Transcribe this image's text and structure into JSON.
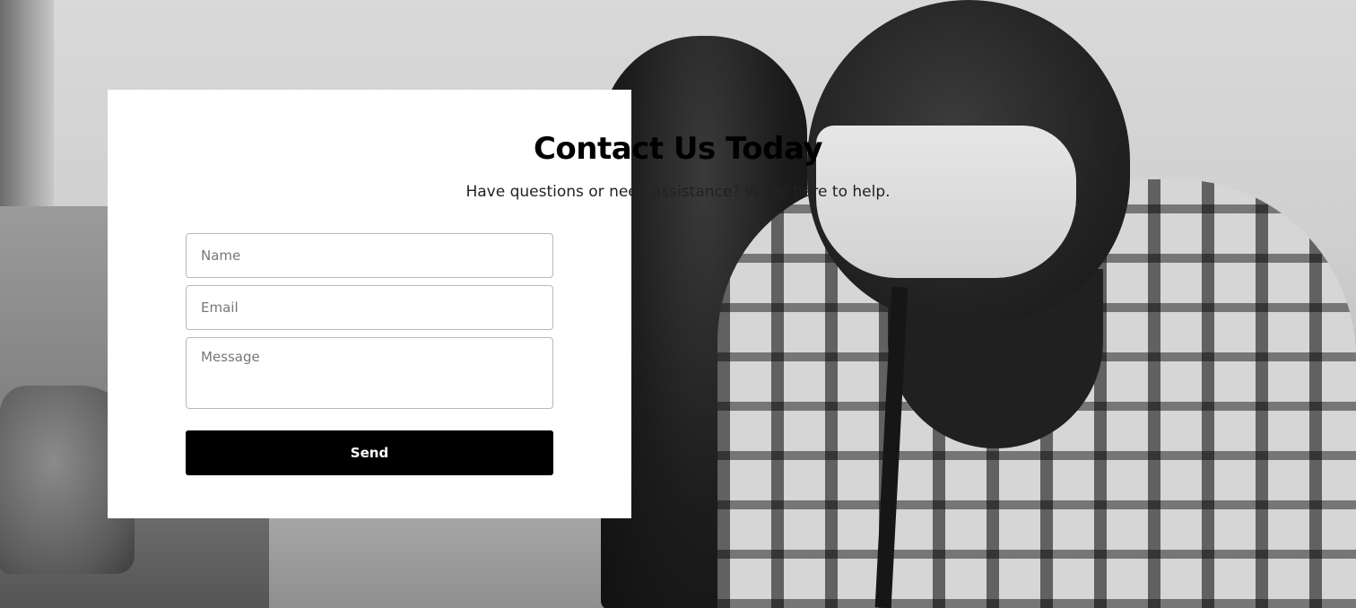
{
  "contact": {
    "title": "Contact Us Today",
    "subtitle": "Have questions or need assistance? We're here to help.",
    "name_placeholder": "Name",
    "email_placeholder": "Email",
    "message_placeholder": "Message",
    "send_label": "Send"
  },
  "colors": {
    "card_background": "#ffffff",
    "button_background": "#000000",
    "button_text": "#ffffff",
    "field_border": "#b8b8b8"
  }
}
